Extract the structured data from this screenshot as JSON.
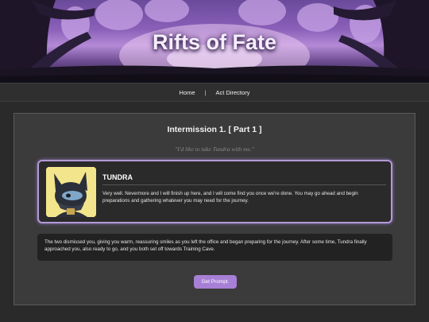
{
  "site": {
    "title": "Rifts of Fate"
  },
  "nav": {
    "items": [
      "Home",
      "Act Directory"
    ],
    "separator": "|"
  },
  "scene": {
    "title": "Intermission 1. [ Part 1 ]",
    "quote": "\"I'd like to take Tundra with me.\""
  },
  "character": {
    "name": "TUNDRA",
    "dialogue": " Very well. Nevermore and I will finish up here, and I will come find you once we're done. You may go ahead and begin preparations and gathering whatever you may need for the journey.",
    "portrait_icon": "tundra-portrait"
  },
  "narration": "The two dismissed you, giving you warm, reassuring smiles as you left the office and began preparing for the journey. After some time, Tundra finally approached you, also ready to go, and you both set off towards Training Cave.",
  "button": {
    "label": "Get Prompt."
  },
  "colors": {
    "accent": "#a77fd6",
    "card_border": "#b39ad6",
    "page_bg": "#2a2a2a",
    "panel_bg": "#3b3b3b"
  }
}
